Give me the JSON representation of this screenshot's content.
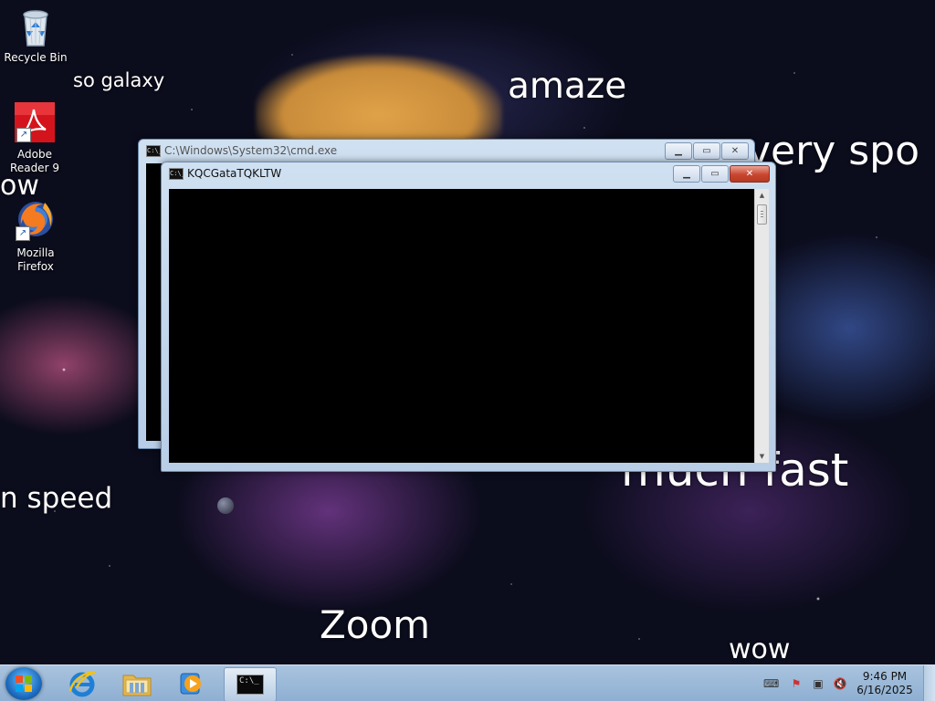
{
  "desktop": {
    "icons": [
      {
        "label": "Recycle Bin",
        "icon": "recycle-bin-icon"
      },
      {
        "label": "Adobe Reader 9",
        "icon": "adobe-reader-icon"
      },
      {
        "label": "Mozilla Firefox",
        "icon": "firefox-icon"
      }
    ],
    "wallpaper_text": {
      "so_galaxy": "so galaxy",
      "amaze": "amaze",
      "very_spo": "very spo",
      "wow_left": "ow",
      "speed": "n speed",
      "much_fast": "much fast",
      "zoom": "Zoom",
      "wow_bottom": "wow"
    }
  },
  "windows": {
    "background": {
      "title": "C:\\Windows\\System32\\cmd.exe",
      "icon": "cmd-icon"
    },
    "foreground": {
      "title": "KQCGataTQKLTW",
      "icon": "cmd-icon"
    }
  },
  "taskbar": {
    "start": "start-orb",
    "pinned": [
      {
        "name": "Internet Explorer",
        "icon": "internet-explorer-icon"
      },
      {
        "name": "Windows Explorer",
        "icon": "folder-icon"
      },
      {
        "name": "Windows Media Player",
        "icon": "media-player-icon"
      },
      {
        "name": "Command Prompt",
        "icon": "cmd-icon",
        "active": true
      }
    ],
    "tray": {
      "icons": [
        "keyboard-icon",
        "action-center-flag-icon",
        "network-icon",
        "volume-muted-icon"
      ],
      "time": "9:46 PM",
      "date": "6/16/2025"
    }
  },
  "colors": {
    "console_bg": "#000000",
    "taskbar_bg": "#a9c3de",
    "close_button": "#c9462f"
  }
}
